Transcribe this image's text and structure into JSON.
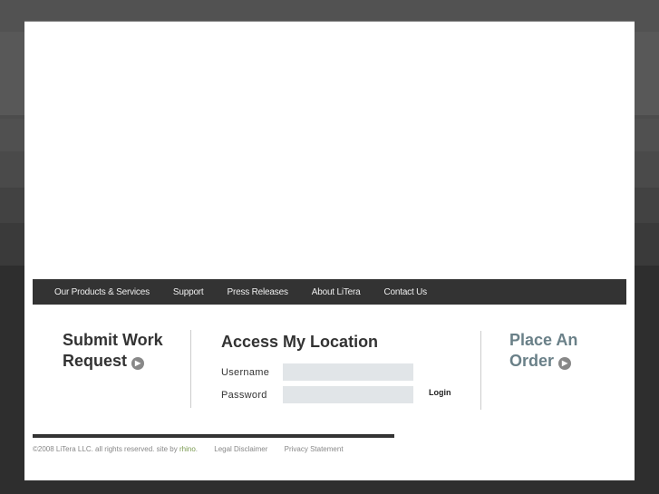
{
  "nav": {
    "items": [
      "Our Products & Services",
      "Support",
      "Press Releases",
      "About LiTera",
      "Contact Us"
    ]
  },
  "submit": {
    "line1": "Submit Work",
    "line2": "Request"
  },
  "access": {
    "title": "Access My Location",
    "username_label": "Username",
    "password_label": "Password",
    "username_value": "",
    "password_value": "",
    "login_label": "Login"
  },
  "order": {
    "line1": "Place An",
    "line2": "Order"
  },
  "footer": {
    "copyright": "©2008 LiTera LLC. all rights reserved. site by ",
    "site_by": "rhino",
    "period": ".",
    "legal": "Legal Disclaimer",
    "privacy": "Privacy Statement"
  },
  "colors": {
    "order_accent": "#6a8088",
    "rhino": "#7a9a50"
  }
}
